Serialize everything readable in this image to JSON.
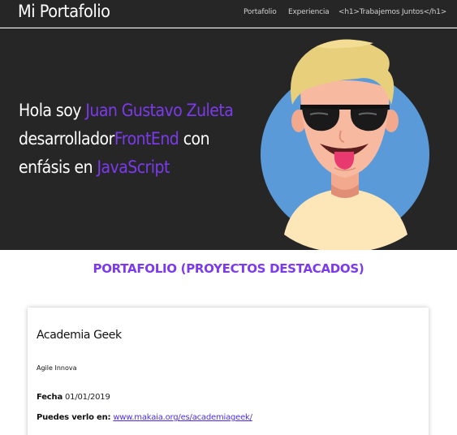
{
  "navbar": {
    "brand": "Mi Portafolio",
    "links": [
      "Portafolio",
      "Experiencia",
      "<h1>Trabajemos Juntos</h1>"
    ]
  },
  "hero": {
    "greeting": "Hola soy ",
    "name": "Juan Gustavo Zuleta",
    "role_prefix": "desarrollador",
    "role": "FrontEnd",
    "role_suffix": " con",
    "emphasis_prefix": "enfásis en ",
    "emphasis": "JavaScript",
    "avatar_icon": "avatar-illustration"
  },
  "section": {
    "title": "PORTAFOLIO (PROYECTOS DESTACADOS)"
  },
  "project": {
    "title": "Academia Geek",
    "company": "Agile Innova",
    "date_label": "Fecha",
    "date_value": "01/01/2019",
    "link_label": "Puedes verlo en:",
    "link_url": "www.makaia.org/es/academiageek/"
  },
  "colors": {
    "accent": "#7c3aed",
    "dark_bg": "#262626",
    "link": "#4b2ee8"
  }
}
